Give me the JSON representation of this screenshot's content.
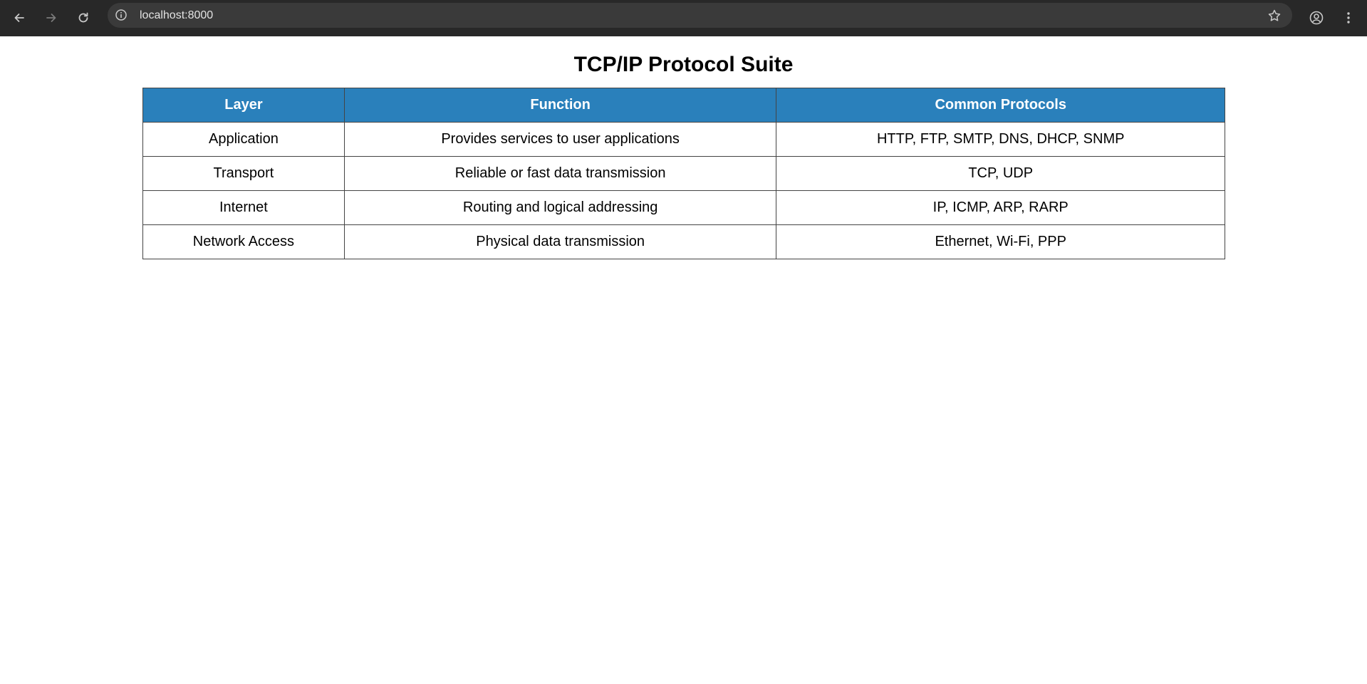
{
  "browser": {
    "url": "localhost:8000",
    "icons": [
      "back-icon",
      "forward-icon",
      "reload-icon",
      "site-info-icon",
      "bookmark-star-icon",
      "profile-icon",
      "menu-icon"
    ]
  },
  "page": {
    "title": "TCP/IP Protocol Suite",
    "table": {
      "headers": [
        "Layer",
        "Function",
        "Common Protocols"
      ],
      "rows": [
        [
          "Application",
          "Provides services to user applications",
          "HTTP, FTP, SMTP, DNS, DHCP, SNMP"
        ],
        [
          "Transport",
          "Reliable or fast data transmission",
          "TCP, UDP"
        ],
        [
          "Internet",
          "Routing and logical addressing",
          "IP, ICMP, ARP, RARP"
        ],
        [
          "Network Access",
          "Physical data transmission",
          "Ethernet, Wi-Fi, PPP"
        ]
      ]
    }
  },
  "colors": {
    "header_bg": "#2a80bb",
    "header_text": "#ffffff",
    "browser_bar": "#282828",
    "border": "#444444"
  }
}
